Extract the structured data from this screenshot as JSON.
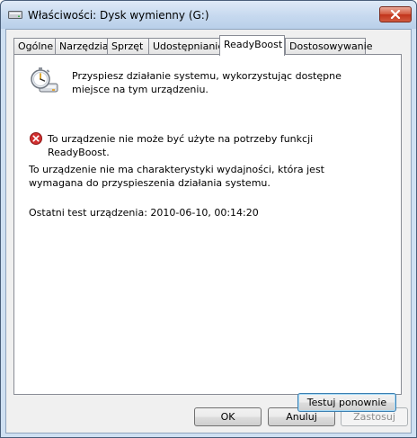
{
  "window": {
    "title": "Właściwości: Dysk wymienny (G:)",
    "drive_icon": "removable-drive-icon",
    "close_icon": "close-icon"
  },
  "tabs": [
    {
      "label": "Ogólne",
      "active": false
    },
    {
      "label": "Narzędzia",
      "active": false
    },
    {
      "label": "Sprzęt",
      "active": false
    },
    {
      "label": "Udostępnianie",
      "active": false
    },
    {
      "label": "ReadyBoost",
      "active": true
    },
    {
      "label": "Dostosowywanie",
      "active": false
    }
  ],
  "readyboost": {
    "icon": "readyboost-stopwatch-icon",
    "intro_line1": "Przyspiesz działanie systemu, wykorzystując dostępne",
    "intro_line2": "miejsce na tym urządzeniu.",
    "error_icon": "error-icon",
    "error_line1": "To urządzenie nie może być użyte na potrzeby funkcji",
    "error_line2": "ReadyBoost.",
    "detail_line1": "To urządzenie nie ma charakterystyki wydajności, która jest",
    "detail_line2": "wymagana do przyspieszenia działania systemu.",
    "last_test": "Ostatni test urządzenia: 2010-06-10, 00:14:20",
    "retest_button": "Testuj ponownie"
  },
  "dialog_buttons": {
    "ok": "OK",
    "cancel": "Anuluj",
    "apply": "Zastosuj"
  },
  "colors": {
    "accent": "#3c7fb1",
    "error": "#d12f2f"
  }
}
